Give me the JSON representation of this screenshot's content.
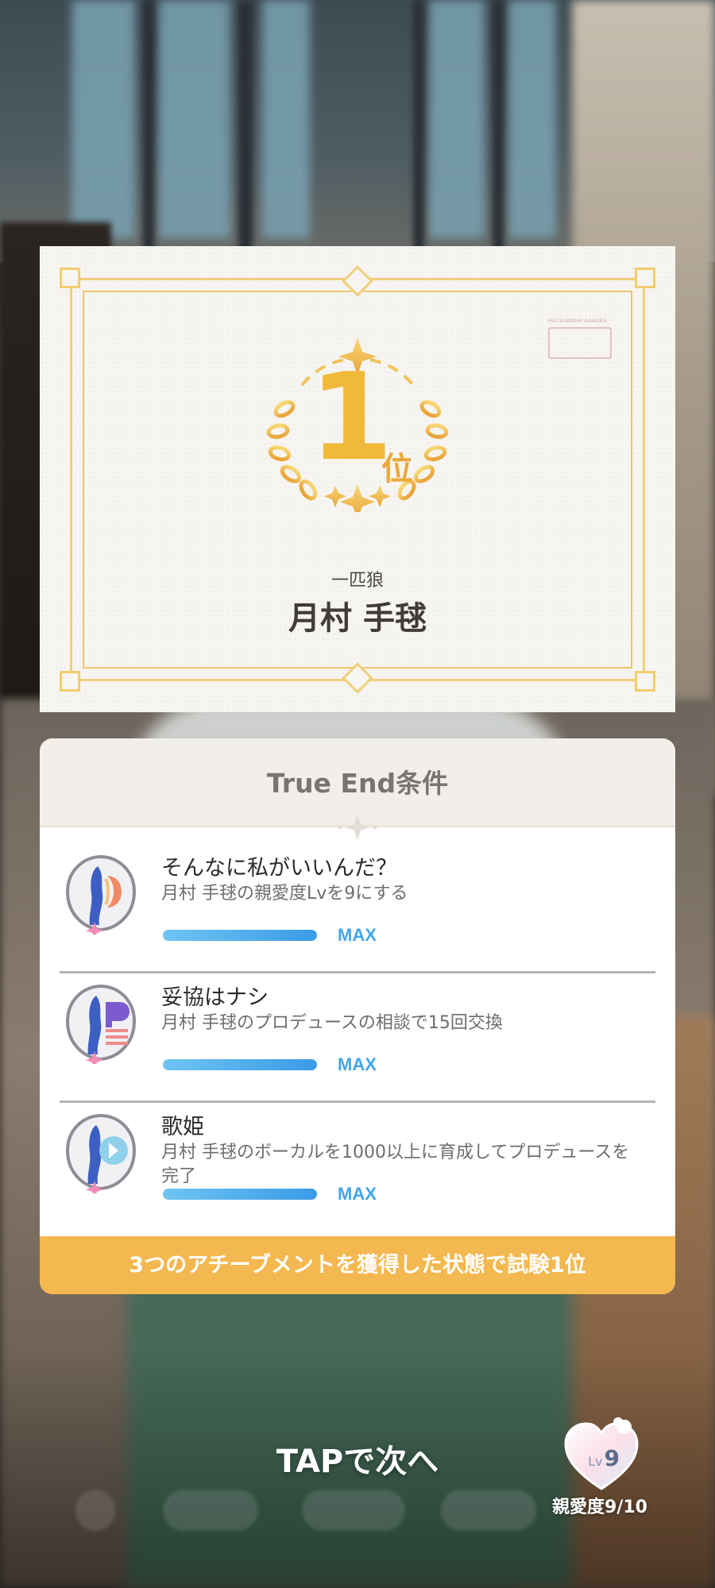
{
  "result_card": {
    "school_logo_text": "HATSUBOSHI GAKUEN",
    "rank_number": "1",
    "rank_suffix": "位",
    "title": "一匹狼",
    "name": "月村 手毬"
  },
  "true_end": {
    "title": "True End条件",
    "achievements": [
      {
        "title": "そんなに私がいいんだ？",
        "description": "月村 手毬の親愛度Lvを9にする",
        "progress": 1.0,
        "progress_label": "MAX",
        "badge_icon": "achievement-badge-icon"
      },
      {
        "title": "妥協はナシ",
        "description": "月村 手毬のプロデュースの相談で15回交換",
        "progress": 1.0,
        "progress_label": "MAX",
        "badge_icon": "achievement-badge-icon"
      },
      {
        "title": "歌姫",
        "description": "月村 手毬のボーカルを1000以上に育成してプロデュースを完了",
        "progress": 1.0,
        "progress_label": "MAX",
        "badge_icon": "achievement-badge-icon"
      }
    ],
    "condition": "3つのアチーブメントを獲得した状態で試験1位"
  },
  "hud": {
    "tap_next": "TAPで次へ",
    "affection": {
      "lv_prefix": "Lv",
      "level": "9",
      "label": "親愛度9/10",
      "icon": "heart-icon"
    }
  },
  "colors": {
    "gold": "#f1b93a",
    "banner": "#f3b84f",
    "progress_blue": "#41a6ea"
  }
}
